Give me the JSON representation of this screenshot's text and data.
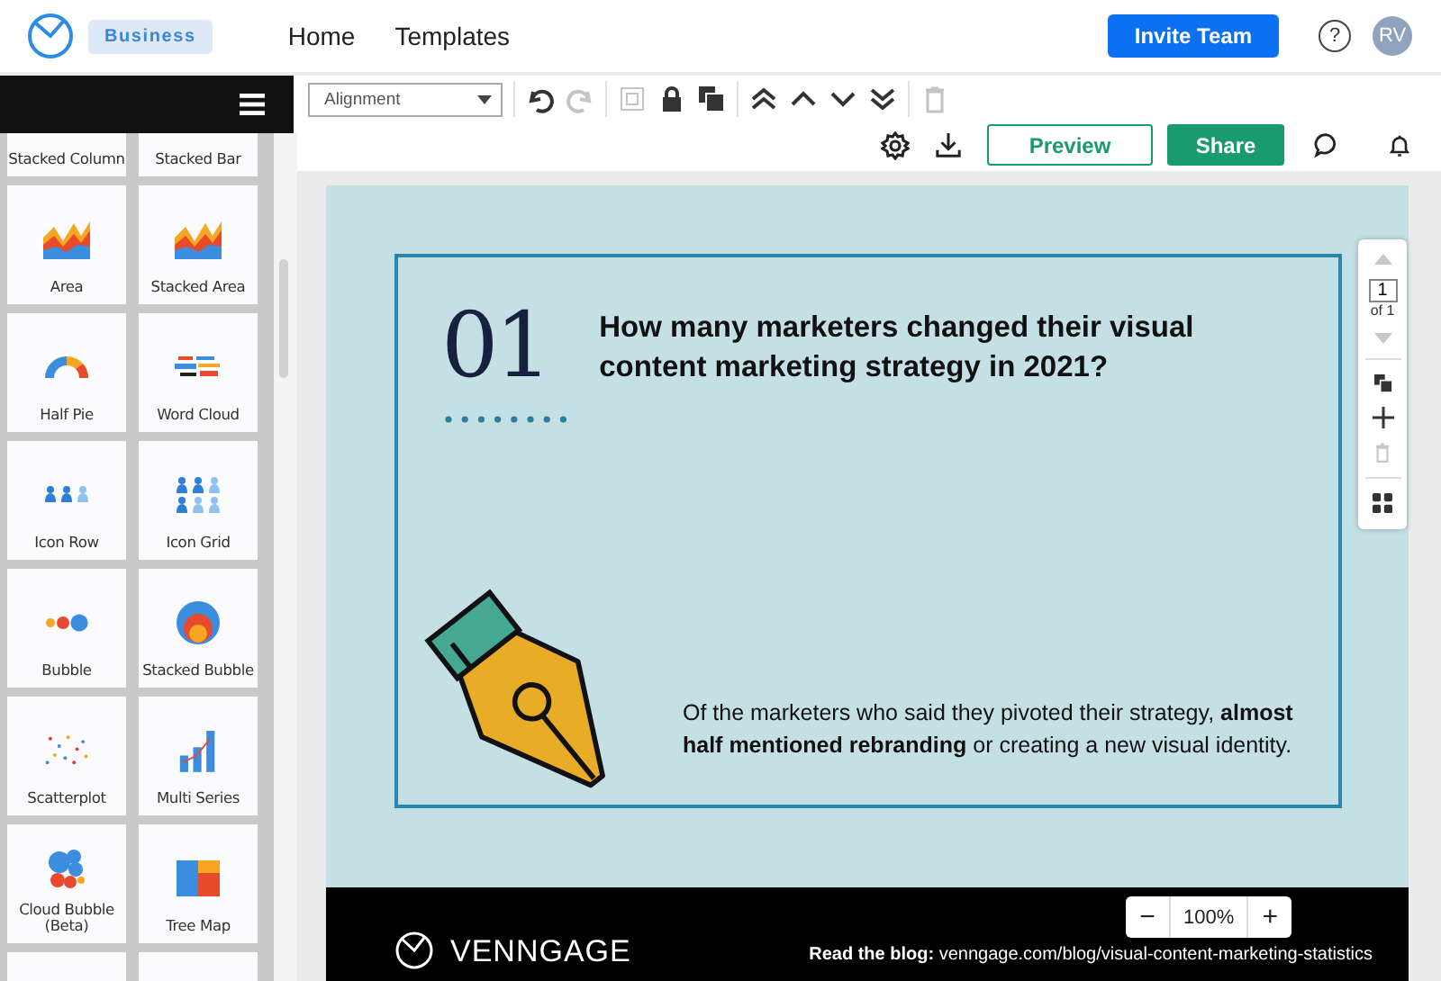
{
  "header": {
    "plan_badge": "Business",
    "nav": [
      "Home",
      "Templates"
    ],
    "invite_button": "Invite Team",
    "help": "?",
    "avatar": "RV"
  },
  "sidebar": {
    "tiles": [
      {
        "label": "Stacked Column",
        "kind": "column"
      },
      {
        "label": "Stacked Bar",
        "kind": "bar"
      },
      {
        "label": "Area",
        "kind": "area"
      },
      {
        "label": "Stacked Area",
        "kind": "area"
      },
      {
        "label": "Half Pie",
        "kind": "halfpie"
      },
      {
        "label": "Word Cloud",
        "kind": "wordcloud"
      },
      {
        "label": "Icon Row",
        "kind": "iconrow"
      },
      {
        "label": "Icon Grid",
        "kind": "icongrid"
      },
      {
        "label": "Bubble",
        "kind": "bubble"
      },
      {
        "label": "Stacked Bubble",
        "kind": "stackedbubble"
      },
      {
        "label": "Scatterplot",
        "kind": "scatter"
      },
      {
        "label": "Multi Series",
        "kind": "multiseries"
      },
      {
        "label": "Cloud Bubble (Beta)",
        "kind": "cloudbubble"
      },
      {
        "label": "Tree Map",
        "kind": "treemap"
      }
    ]
  },
  "toolbar": {
    "alignment_select": "Alignment",
    "tools": [
      {
        "kind": "undo",
        "disabled": false
      },
      {
        "kind": "redo",
        "disabled": true
      },
      {
        "kind": "group",
        "disabled": true
      },
      {
        "kind": "lock",
        "disabled": false
      },
      {
        "kind": "duplicate",
        "disabled": false
      },
      {
        "kind": "front",
        "disabled": false
      },
      {
        "kind": "forward",
        "disabled": false
      },
      {
        "kind": "backward",
        "disabled": false
      },
      {
        "kind": "back",
        "disabled": false
      },
      {
        "kind": "delete",
        "disabled": true
      }
    ],
    "preview_button": "Preview",
    "share_button": "Share"
  },
  "canvas": {
    "number": "01",
    "question": "How many marketers changed their visual content marketing strategy in 2021?",
    "body": "Of the marketers who said they pivoted their strategy, **almost half mentioned rebranding** or creating a new visual identity.",
    "footer_brand": "VENNGAGE",
    "footer_link": "**Read the blog:** venngage.com/blog/visual-content-marketing-statistics"
  },
  "page_panel": {
    "page": "1",
    "of": "of 1",
    "prev_disabled": true,
    "next_disabled": true,
    "delete_disabled": true
  },
  "zoom": {
    "minus": "−",
    "level": "100%",
    "plus": "+"
  }
}
